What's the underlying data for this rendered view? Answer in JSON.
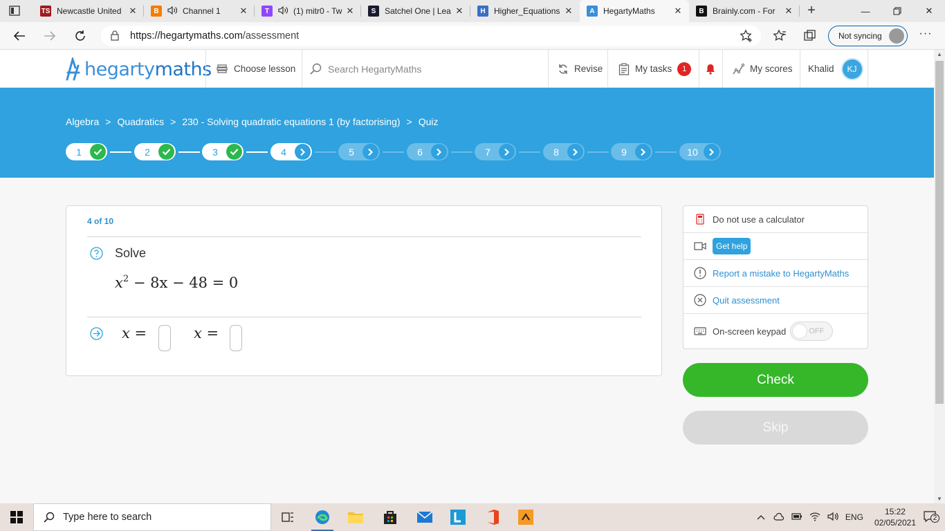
{
  "browser": {
    "tabs": [
      {
        "title": "Newcastle United",
        "favicon": "TS",
        "color": "#a3191e",
        "audio": false
      },
      {
        "title": "Channel 1",
        "favicon": "B",
        "color": "#f57d00",
        "audio": true
      },
      {
        "title": "(1) mitr0 - Tw",
        "favicon": "T",
        "color": "#9146ff",
        "audio": true
      },
      {
        "title": "Satchel One | Lea",
        "favicon": "S",
        "color": "#1a1a2e",
        "audio": false
      },
      {
        "title": "Higher_Equations",
        "favicon": "H",
        "color": "#3a6fc4",
        "audio": false
      },
      {
        "title": "HegartyMaths",
        "favicon": "A",
        "color": "#3a8fd9",
        "audio": false,
        "active": true
      },
      {
        "title": "Brainly.com - For",
        "favicon": "B",
        "color": "#111111",
        "audio": false
      }
    ],
    "url_host": "https://hegartymaths.com",
    "url_path": "/assessment",
    "sync_label": "Not syncing"
  },
  "header": {
    "logo_hegarty": "hegarty",
    "logo_maths": "maths",
    "choose_lesson": "Choose lesson",
    "search_placeholder": "Search HegartyMaths",
    "revise": "Revise",
    "my_tasks": "My tasks",
    "tasks_count": "1",
    "my_scores": "My scores",
    "user_name": "Khalid",
    "user_initials": "KJ"
  },
  "breadcrumb": [
    "Algebra",
    "Quadratics",
    "230 - Solving quadratic equations 1 (by factorising)",
    "Quiz"
  ],
  "steps": [
    {
      "n": "1",
      "state": "done"
    },
    {
      "n": "2",
      "state": "done"
    },
    {
      "n": "3",
      "state": "done"
    },
    {
      "n": "4",
      "state": "current"
    },
    {
      "n": "5",
      "state": "pending"
    },
    {
      "n": "6",
      "state": "pending"
    },
    {
      "n": "7",
      "state": "pending"
    },
    {
      "n": "8",
      "state": "pending"
    },
    {
      "n": "9",
      "state": "pending"
    },
    {
      "n": "10",
      "state": "pending"
    }
  ],
  "question": {
    "progress": "4 of 10",
    "prompt": "Solve",
    "equation": {
      "var": "x",
      "power": "2",
      "rest": "− 8x − 48 = 0"
    },
    "answer_label": "x ="
  },
  "side": {
    "calculator": "Do not use a calculator",
    "get_help": "Get help",
    "report": "Report a mistake to HegartyMaths",
    "quit": "Quit assessment",
    "keypad": "On-screen keypad",
    "keypad_state": "OFF"
  },
  "buttons": {
    "check": "Check",
    "skip": "Skip"
  },
  "taskbar": {
    "search_placeholder": "Type here to search",
    "lang": "ENG",
    "time": "15:22",
    "date": "02/05/2021",
    "notifications": "2"
  }
}
